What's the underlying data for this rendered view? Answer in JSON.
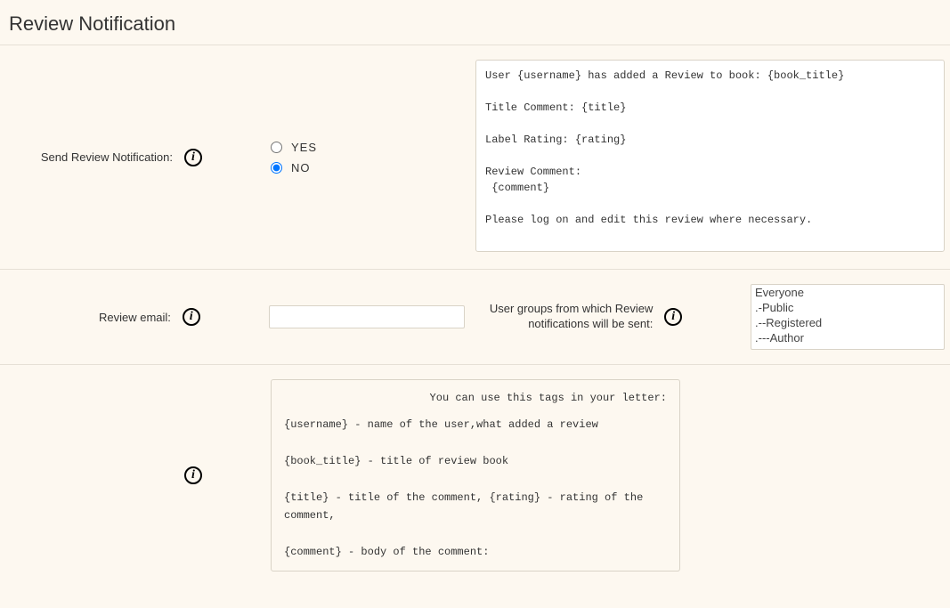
{
  "page": {
    "title": "Review Notification"
  },
  "section1": {
    "label": "Send Review Notification:",
    "radio_yes": "YES",
    "radio_no": "NO",
    "radio_selected": "no",
    "template_text": "User {username} has added a Review to book: {book_title}\n\nTitle Comment: {title}\n\nLabel Rating: {rating}\n\nReview Comment:\n {comment}\n\nPlease log on and edit this review where necessary."
  },
  "section2": {
    "email_label": "Review email:",
    "email_value": "",
    "groups_label": "User groups from which Review notifications will be sent:",
    "groups_options": [
      "Everyone",
      ".-Public",
      ".--Registered",
      ".---Author"
    ]
  },
  "section3": {
    "help_header": "You can use this tags in your letter:",
    "help_lines": "{username} - name of the user,what added a review\n\n{book_title} - title of review book\n\n{title} - title of the comment, {rating} - rating of the comment,\n\n{comment} - body of the comment:"
  },
  "icons": {
    "info": "i"
  }
}
